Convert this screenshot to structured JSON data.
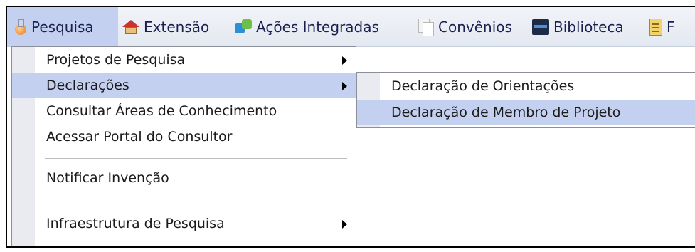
{
  "menubar": {
    "items": [
      {
        "label": "Pesquisa",
        "icon": "flask-icon"
      },
      {
        "label": "Extensão",
        "icon": "house-icon"
      },
      {
        "label": "Ações Integradas",
        "icon": "puzzle-icon"
      },
      {
        "label": "Convênios",
        "icon": "documents-icon"
      },
      {
        "label": "Biblioteca",
        "icon": "book-icon"
      },
      {
        "label": "F",
        "icon": "note-icon"
      }
    ]
  },
  "dropdown": {
    "items": [
      {
        "label": "Projetos de Pesquisa"
      },
      {
        "label": "Declarações"
      },
      {
        "label": "Consultar Áreas de Conhecimento"
      },
      {
        "label": "Acessar Portal do Consultor"
      },
      {
        "label": "Notificar Invenção"
      },
      {
        "label": "Infraestrutura de Pesquisa"
      }
    ]
  },
  "submenu": {
    "items": [
      {
        "label": "Declaração de Orientações"
      },
      {
        "label": "Declaração de Membro de Projeto"
      }
    ]
  },
  "colors": {
    "highlight": "#c4d0ef",
    "menubar_text": "#1b1f50",
    "gutter": "#e9ebf0"
  }
}
